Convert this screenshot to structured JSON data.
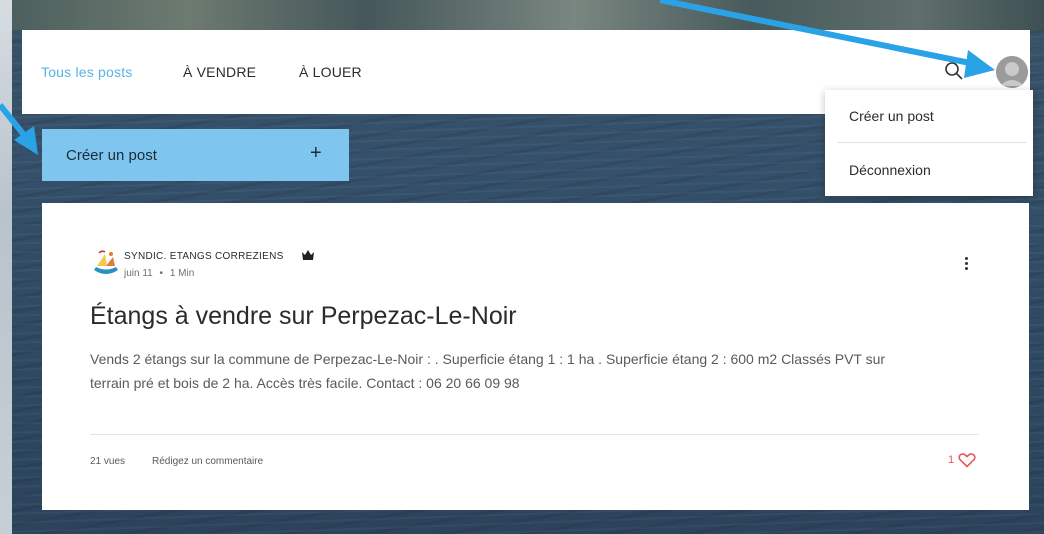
{
  "nav": {
    "tabs": [
      {
        "label": "Tous les posts",
        "active": true
      },
      {
        "label": "À VENDRE",
        "active": false
      },
      {
        "label": "À LOUER",
        "active": false
      }
    ],
    "search_icon": "search-icon",
    "avatar_icon": "user-avatar"
  },
  "dropdown": {
    "items": [
      {
        "label": "Créer un post"
      },
      {
        "label": "Déconnexion"
      }
    ]
  },
  "create_button": {
    "label": "Créer un post",
    "icon": "+"
  },
  "post": {
    "author": "SYNDIC. ETANGS CORREZIENS",
    "date": "juin 11",
    "separator": "•",
    "read_time": "1 Min",
    "title": "Étangs à vendre sur Perpezac-Le-Noir",
    "excerpt": "Vends 2 étangs sur la commune de Perpezac-Le-Noir : . Superficie étang 1 : 1 ha . Superficie étang 2 : 600 m2 Classés PVT sur terrain pré et bois de 2 ha. Accès très facile. Contact : 06 20 66 09 98",
    "views": "21 vues",
    "comment_label": "Rédigez un commentaire",
    "likes": "1"
  },
  "colors": {
    "accent": "#58b3e8",
    "button": "#7ec6f0",
    "like": "#e35a5a",
    "annotation_arrow": "#2aa3e6"
  }
}
